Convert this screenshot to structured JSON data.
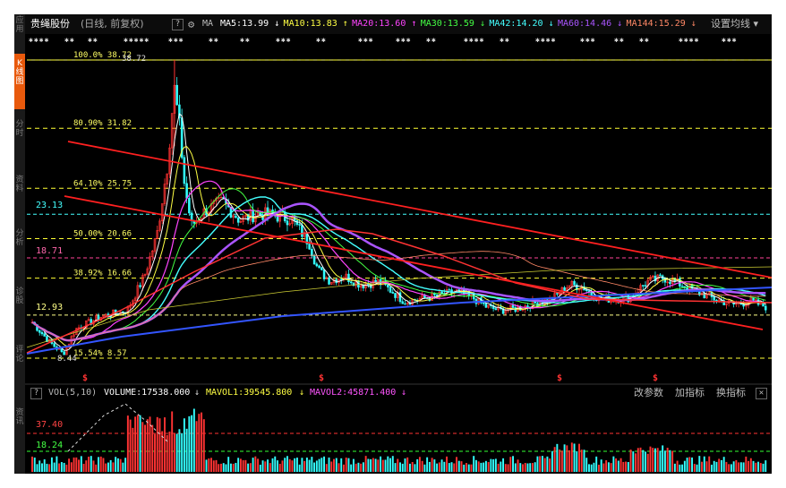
{
  "header": {
    "stock_name": "贵绳股份",
    "period": "(日线, 前复权)",
    "help": "?",
    "ma_label": "MA",
    "ma": [
      {
        "label": "MA5:13.99",
        "arrow": "↓",
        "color": "#ffffff"
      },
      {
        "label": "MA10:13.83",
        "arrow": "↑",
        "color": "#ffff44"
      },
      {
        "label": "MA20:13.60",
        "arrow": "↑",
        "color": "#ff44ff"
      },
      {
        "label": "MA30:13.59",
        "arrow": "↓",
        "color": "#44ff44"
      },
      {
        "label": "MA42:14.20",
        "arrow": "↓",
        "color": "#44ffff"
      },
      {
        "label": "MA60:14.46",
        "arrow": "↓",
        "color": "#aa55ff"
      },
      {
        "label": "MA144:15.29",
        "arrow": "↓",
        "color": "#ff8866"
      }
    ],
    "settings": "设置均线"
  },
  "sidebar": [
    "应用",
    "K线图",
    "分时",
    "资料",
    "分析",
    "诊股",
    "评论",
    "资讯"
  ],
  "price_labels": {
    "high": "38.72",
    "low": "8.44",
    "level_23": "23.13",
    "level_18": "18.71",
    "level_12": "12.93"
  },
  "fib_levels": [
    {
      "label": "100.0% 38.72",
      "price": 38.72
    },
    {
      "label": "80.90% 31.82",
      "price": 31.82
    },
    {
      "label": "64.10% 25.75",
      "price": 25.75
    },
    {
      "label": "50.00% 20.66",
      "price": 20.66
    },
    {
      "label": "38.92% 16.66",
      "price": 16.66
    },
    {
      "label": "15.54% 8.57",
      "price": 8.57
    }
  ],
  "volume": {
    "title": "VOL(5,10)",
    "volume": "VOLUME:17538.000",
    "mavol1": "MAVOL1:39545.800",
    "mavol2": "MAVOL2:45871.400",
    "level_high": "37.40",
    "level_low": "18.24",
    "buttons": [
      "改参数",
      "加指标",
      "换指标"
    ]
  },
  "colors": {
    "up": "#ff3333",
    "down": "#33ffff",
    "trend": "#ff2020",
    "fib": "#ffff33"
  }
}
